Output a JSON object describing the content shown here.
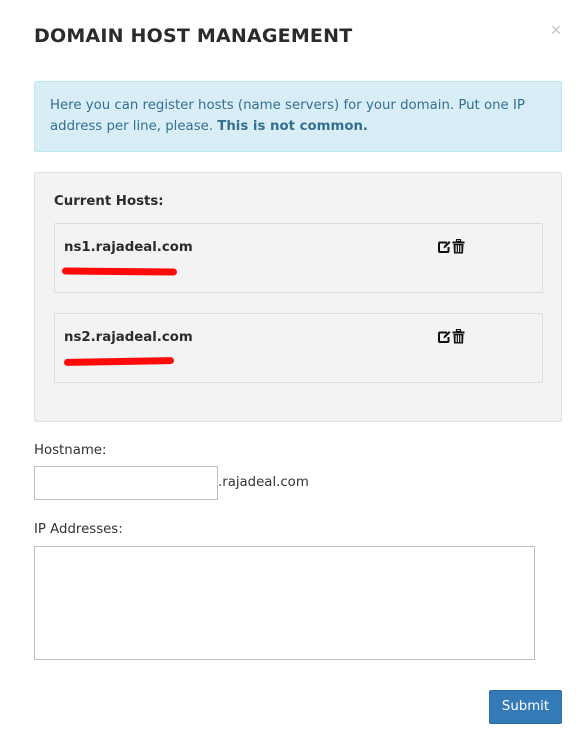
{
  "modal": {
    "title": "DOMAIN HOST MANAGEMENT",
    "close_label": "×"
  },
  "alert": {
    "text": "Here you can register hosts (name servers) for your domain. Put one IP address per line, please. ",
    "bold_text": "This is not common.",
    "bg_color": "#d9edf7",
    "text_color": "#31708f"
  },
  "hosts": {
    "heading": "Current Hosts:",
    "items": [
      {
        "name": "ns1.rajadeal.com",
        "actions": [
          "edit-icon",
          "trash-icon"
        ]
      },
      {
        "name": "ns2.rajadeal.com",
        "actions": [
          "edit-icon",
          "trash-icon"
        ]
      }
    ],
    "redaction_color": "#ff0a0a"
  },
  "form": {
    "hostname_label": "Hostname:",
    "hostname_value": "",
    "hostname_suffix": ".rajadeal.com",
    "ip_label": "IP Addresses:",
    "ip_value": "",
    "submit_label": "Submit",
    "submit_color": "#337ab7"
  }
}
